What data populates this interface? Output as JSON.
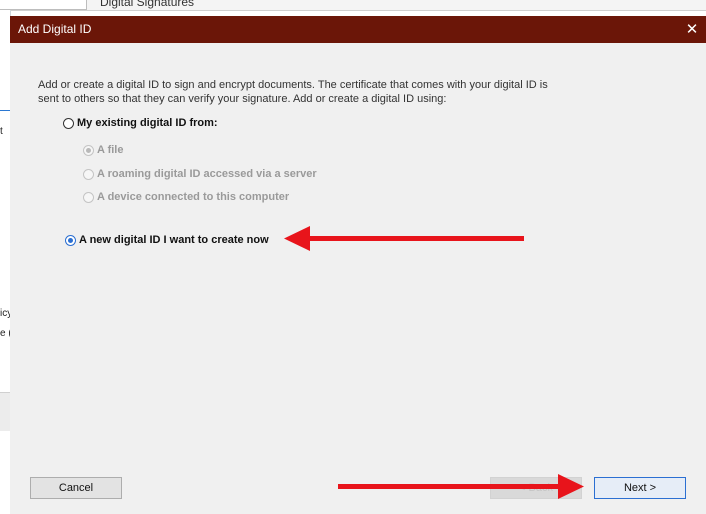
{
  "background_window": {
    "title_fragment": "Digital Signatures",
    "left_fragments": [
      "t",
      "icy",
      "e (",
      "ec"
    ]
  },
  "dialog": {
    "title": "Add Digital ID",
    "close_glyph": "✕",
    "description": "Add or create a digital ID to sign and encrypt documents. The certificate that comes with your digital ID is sent to others so that they can verify your signature. Add or create a digital ID using:",
    "options": {
      "existing": {
        "label": "My existing digital ID from:",
        "selected": false
      },
      "file": {
        "label": "A file",
        "selected": true,
        "enabled": false
      },
      "roaming": {
        "label": "A roaming digital ID accessed via a server",
        "selected": false,
        "enabled": false
      },
      "device": {
        "label": "A device connected to this computer",
        "selected": false,
        "enabled": false
      },
      "new": {
        "label": "A new digital ID I want to create now",
        "selected": true
      }
    },
    "buttons": {
      "cancel": "Cancel",
      "back": "< Back",
      "next": "Next >"
    }
  },
  "colors": {
    "titlebar": "#6b1608",
    "accent": "#2b6fd2",
    "annotation_arrow": "#e8141b"
  }
}
